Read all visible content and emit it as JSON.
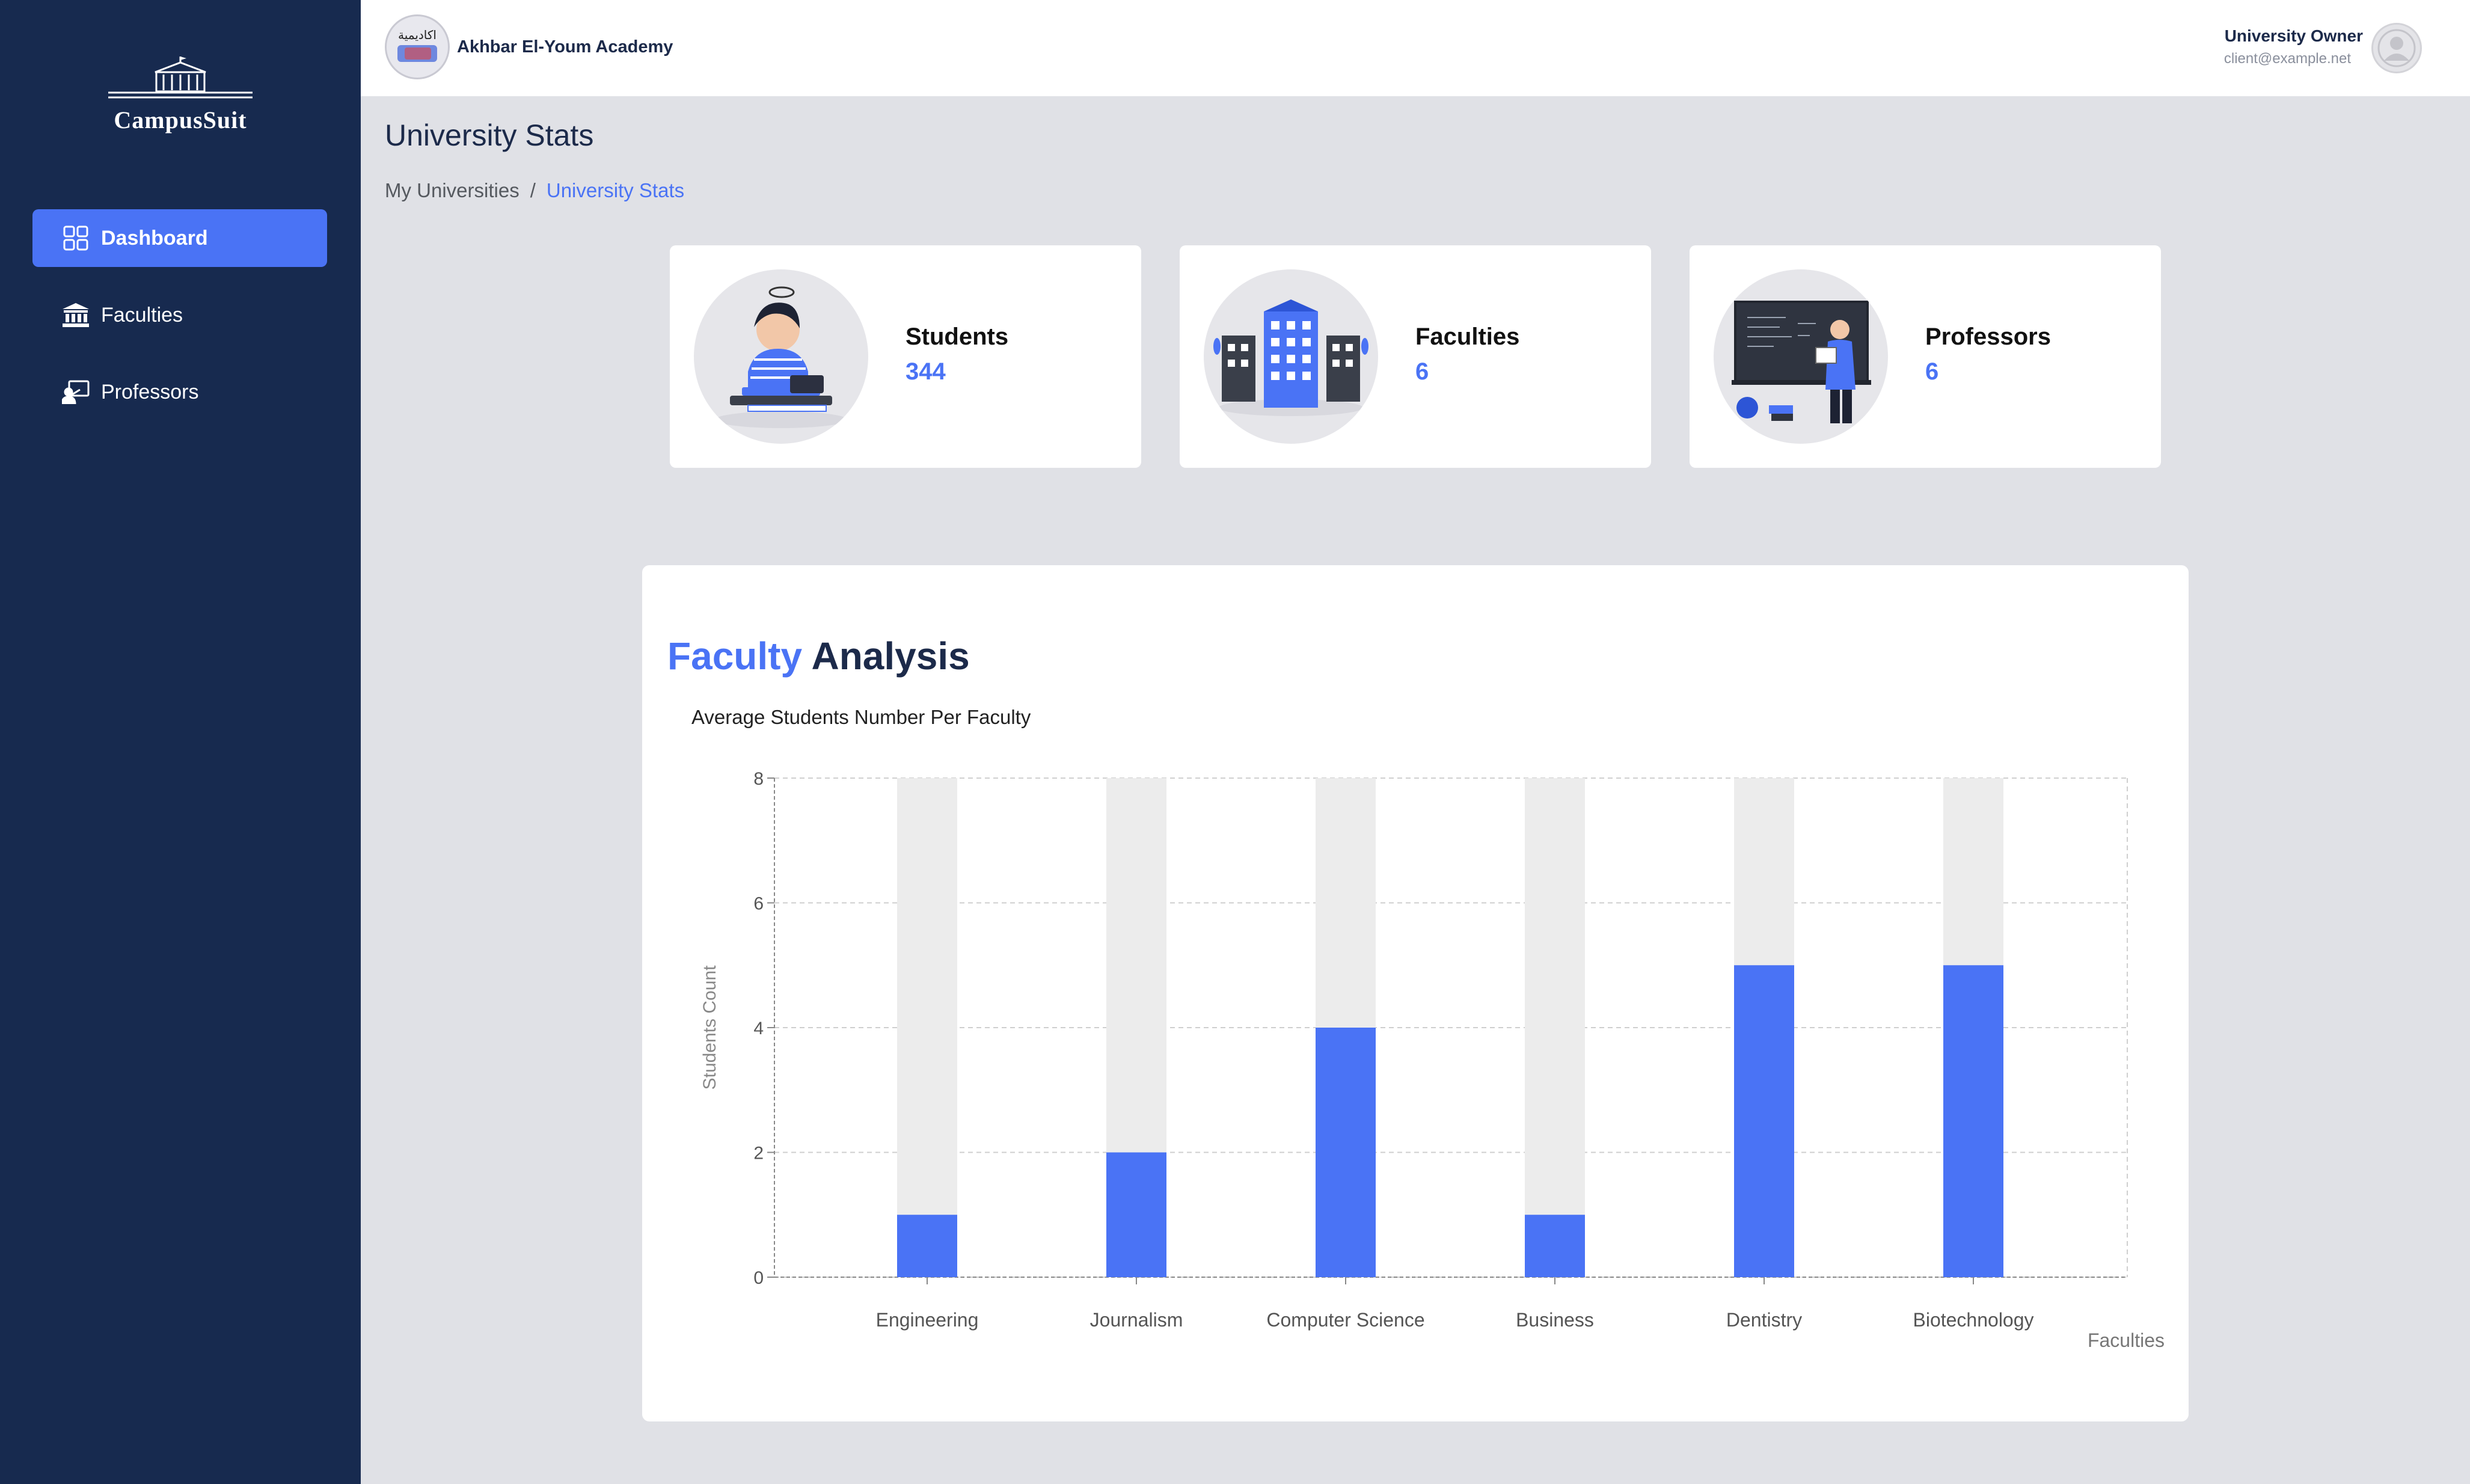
{
  "sidebar": {
    "brand": "CampusSuit",
    "items": [
      {
        "label": "Dashboard",
        "icon": "grid-icon",
        "active": true
      },
      {
        "label": "Faculties",
        "icon": "institution-icon",
        "active": false
      },
      {
        "label": "Professors",
        "icon": "professor-icon",
        "active": false
      }
    ]
  },
  "header": {
    "university_name": "Akhbar El-Youm Academy",
    "logo_text": "اكاديمية",
    "user_name": "University Owner",
    "user_email": "client@example.net"
  },
  "page": {
    "title": "University Stats",
    "breadcrumb": [
      "My Universities",
      "/",
      "University Stats"
    ]
  },
  "stats": [
    {
      "label": "Students",
      "value": "344",
      "illustration": "student-illustration"
    },
    {
      "label": "Faculties",
      "value": "6",
      "illustration": "building-illustration"
    },
    {
      "label": "Professors",
      "value": "6",
      "illustration": "professor-illustration"
    }
  ],
  "chart_section": {
    "title_accent": "Faculty",
    "title_rest": "Analysis",
    "subtitle": "Average Students Number Per Faculty"
  },
  "colors": {
    "accent": "#4a73f5",
    "sidebar": "#172a4f",
    "bar_background": "#ececec"
  },
  "chart_data": {
    "type": "bar",
    "categories": [
      "Engineering",
      "Journalism",
      "Computer Science",
      "Business",
      "Dentistry",
      "Biotechnology"
    ],
    "values": [
      1,
      2,
      4,
      1,
      5,
      5
    ],
    "background_max": 8,
    "title": "Average Students Number Per Faculty",
    "xlabel": "Faculties",
    "ylabel": "Students Count",
    "ylim": [
      0,
      8
    ],
    "yticks": [
      0,
      2,
      4,
      6,
      8
    ],
    "grid": true
  }
}
